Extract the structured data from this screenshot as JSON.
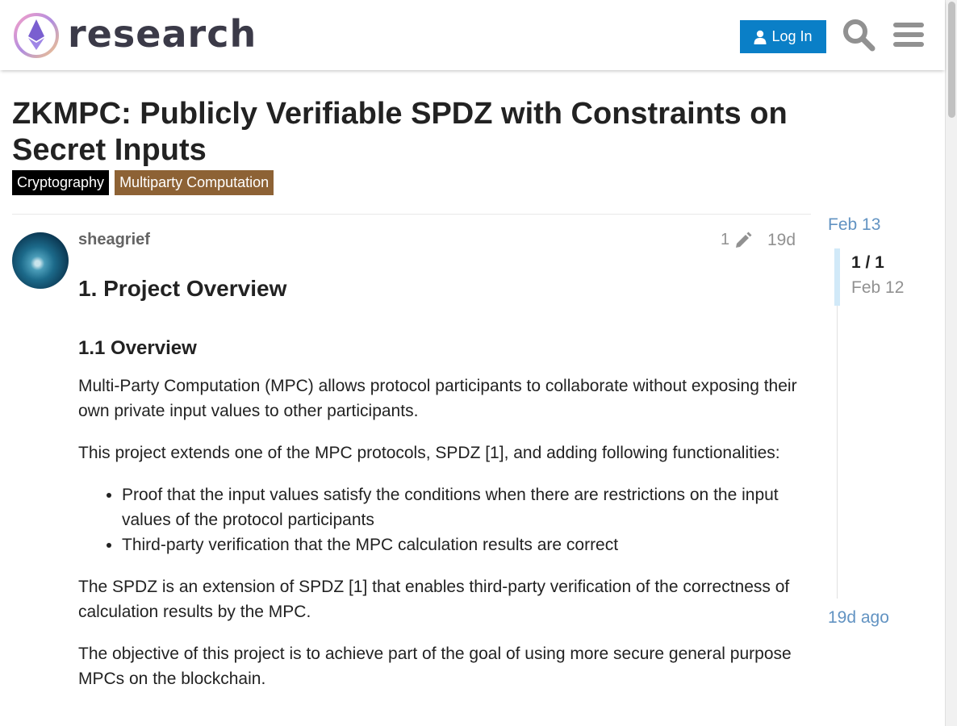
{
  "header": {
    "logo_text": "research",
    "login_label": "Log In"
  },
  "topic": {
    "title": "ZKMPC: Publicly Verifiable SPDZ with Constraints on Secret Inputs",
    "tags": [
      {
        "label": "Cryptography",
        "color": "#000000"
      },
      {
        "label": "Multiparty Computation",
        "color": "#8d6235"
      }
    ]
  },
  "post": {
    "username": "sheagrief",
    "edit_count": "1",
    "age": "19d",
    "h1": "1. Project Overview",
    "h2": "1.1 Overview",
    "paragraphs": [
      "Multi-Party Computation (MPC) allows protocol participants to collaborate without exposing their own private input values to other participants.",
      "This project extends one of the MPC protocols, SPDZ [1], and adding following functionalities:"
    ],
    "bullets": [
      "Proof that the input values satisfy the conditions when there are restrictions on the input values of the protocol participants",
      "Third-party verification that the MPC calculation results are correct"
    ],
    "paragraphs_after": [
      "The SPDZ is an extension of SPDZ [1] that enables third-party verification of the correctness of calculation results by the MPC.",
      "The objective of this project is to achieve part of the goal of using more secure general purpose MPCs on the blockchain."
    ]
  },
  "timeline": {
    "start_date": "Feb 13",
    "position": "1 / 1",
    "current_date": "Feb 12",
    "end_label": "19d ago"
  },
  "colors": {
    "accent": "#0a7fc7",
    "link": "#6293c2"
  }
}
